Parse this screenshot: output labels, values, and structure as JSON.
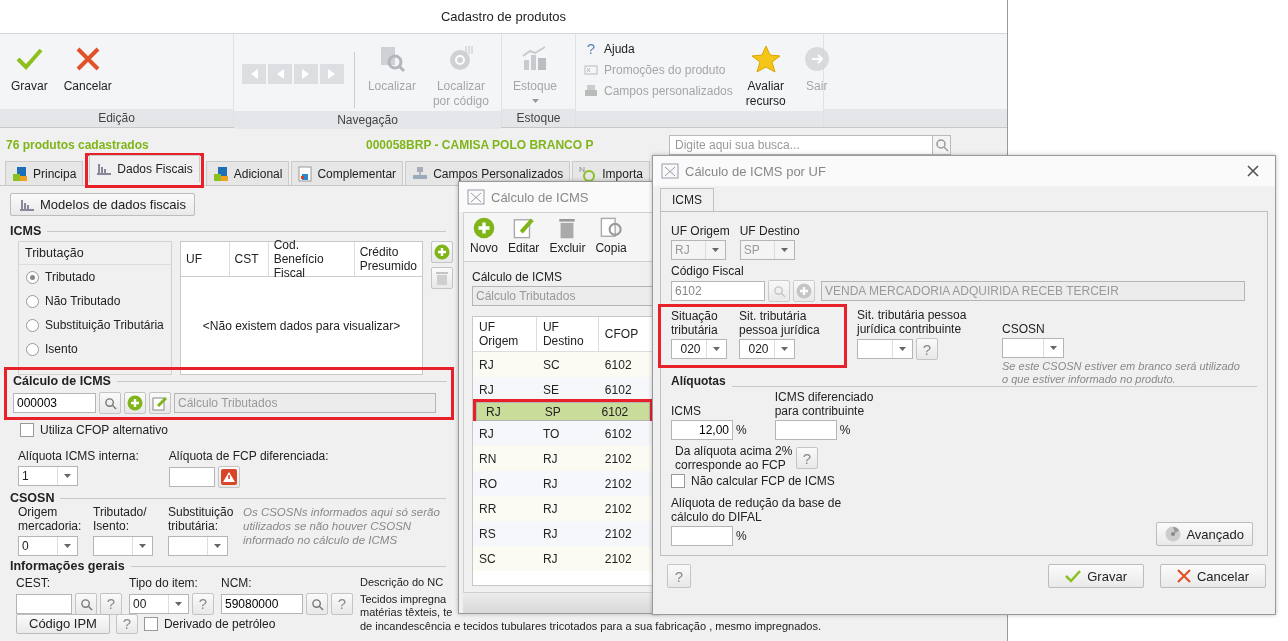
{
  "main_window": {
    "title": "Cadastro de produtos"
  },
  "ribbon": {
    "edit_group": {
      "label": "Edição",
      "save_button": {
        "text": "Gravar",
        "disabled": false
      },
      "cancel_button": {
        "text": "Cancelar",
        "disabled": false
      }
    },
    "navigation_group": {
      "label": "Navegação",
      "pager": {
        "disabled": true
      },
      "find_button": {
        "text": "Localizar",
        "disabled": true
      },
      "find_by_code_button": {
        "text": "Localizar por código",
        "disabled": true
      }
    },
    "stock_group": {
      "label": "Estoque",
      "stock_button": {
        "text": "Estoque",
        "disabled": true
      }
    },
    "misc_group": {
      "help_link": {
        "mark": "?",
        "text": "Ajuda",
        "disabled": false
      },
      "promotions_link": {
        "text": "Promoções do produto",
        "disabled": true
      },
      "custom_fields_link": {
        "text": "Campos personalizados",
        "disabled": true
      },
      "rate_button": {
        "text": "Avaliar recurso",
        "disabled": false
      },
      "exit_button": {
        "text": "Sair",
        "disabled": true
      }
    }
  },
  "record_bar": {
    "count": "76 produtos cadastrados",
    "product": "000058BRP - CAMISA POLO BRANCO P",
    "search": {
      "placeholder": "Digite aqui sua busca..."
    }
  },
  "tabs": [
    {
      "label": "Principa",
      "selected": false
    },
    {
      "label": "Dados Fiscais",
      "selected": true
    },
    {
      "label": "Adicional",
      "selected": false
    },
    {
      "label": "Complementar",
      "selected": false
    },
    {
      "label": "Campos Personalizados",
      "selected": false
    },
    {
      "label": "Importa",
      "selected": false
    }
  ],
  "fiscal": {
    "models_button": "Modelos de dados fiscais",
    "icms": {
      "title": "ICMS",
      "taxation": {
        "title": "Tributação",
        "options": [
          {
            "label": "Tributado",
            "selected": true
          },
          {
            "label": "Não Tributado",
            "selected": false
          },
          {
            "label": "Substituição Tributária",
            "selected": false
          },
          {
            "label": "Isento",
            "selected": false
          }
        ]
      },
      "table": {
        "columns": [
          "UF",
          "CST",
          "Cod. Benefício Fiscal",
          "Crédito Presumido"
        ],
        "empty_message": "<Não existem dados para visualizar>"
      }
    },
    "icms_calc": {
      "title": "Cálculo de ICMS",
      "code": "000003",
      "name": "Cálculo Tributados"
    },
    "alt_cfop": {
      "label": "Utiliza CFOP alternativo",
      "checked": false
    },
    "internal_rate": {
      "label": "Alíquota ICMS interna:",
      "value": "1"
    },
    "fcp_rate": {
      "label": "Alíquota de FCP diferenciada:"
    },
    "csosn": {
      "title": "CSOSN",
      "fields": [
        {
          "label": "Origem mercadoria:",
          "value": "0"
        },
        {
          "label": "Tributado/ Isento:"
        },
        {
          "label": "Substituição tributária:"
        }
      ],
      "note": "Os CSOSNs informados aqui só serão utilizados se não houver CSOSN informado no cálculo de ICMS"
    },
    "general": {
      "title": "Informações gerais",
      "cest": {
        "label": "CEST:",
        "help": "?"
      },
      "item_type": {
        "label": "Tipo do item:",
        "value": "00",
        "help": "?"
      },
      "ncm": {
        "label": "NCM:",
        "value": "59080000",
        "help": "?"
      },
      "ncm_description": {
        "label": "Descrição do NC",
        "lines": [
          "Tecidos impregna",
          "matérias têxteis, te",
          "de incandescência e tecidos tubulares tricotados para a sua fabricação , mesmo impregnados."
        ]
      },
      "ipm_button": "Código IPM",
      "ipm_help": "?",
      "petroleum": {
        "label": "Derivado de petróleo",
        "checked": false
      }
    }
  },
  "icms_list_dialog": {
    "title": "Cálculo de ICMS",
    "toolbar": [
      "Novo",
      "Editar",
      "Excluir",
      "Copia"
    ],
    "calc_label": "Cálculo de ICMS",
    "calc_value": "Cálculo Tributados",
    "columns": [
      "UF Origem",
      "UF Destino",
      "CFOP"
    ],
    "rows": [
      {
        "cells": [
          "RJ",
          "SC",
          "6102"
        ],
        "selected": false
      },
      {
        "cells": [
          "RJ",
          "SE",
          "6102"
        ],
        "selected": false
      },
      {
        "cells": [
          "RJ",
          "SP",
          "6102"
        ],
        "selected": true
      },
      {
        "cells": [
          "RJ",
          "TO",
          "6102"
        ],
        "selected": false
      },
      {
        "cells": [
          "RN",
          "RJ",
          "2102"
        ],
        "selected": false
      },
      {
        "cells": [
          "RO",
          "RJ",
          "2102"
        ],
        "selected": false
      },
      {
        "cells": [
          "RR",
          "RJ",
          "2102"
        ],
        "selected": false
      },
      {
        "cells": [
          "RS",
          "RJ",
          "2102"
        ],
        "selected": false
      },
      {
        "cells": [
          "SC",
          "RJ",
          "2102"
        ],
        "selected": false
      }
    ]
  },
  "uf_dialog": {
    "title": "Cálculo de ICMS por UF",
    "tab": "ICMS",
    "origin": {
      "label": "UF Origem",
      "value": "RJ",
      "disabled": true
    },
    "destination": {
      "label": "UF Destino",
      "value": "SP",
      "disabled": true
    },
    "fiscal_code": {
      "label": "Código Fiscal",
      "value": "6102",
      "disabled": true,
      "description": "VENDA MERCADORIA ADQUIRIDA RECEB TERCEIR"
    },
    "tax_situation": {
      "label": "Situação tributária",
      "value": "020"
    },
    "legal_entity_situation": {
      "label": "Sit. tributária pessoa jurídica",
      "value": "020"
    },
    "contributor_situation": {
      "label": "Sit. tributária pessoa jurídica contribuinte",
      "help": "?"
    },
    "csosn": {
      "label": "CSOSN",
      "note": "Se este CSOSN estiver em branco será utilizado o que estiver informado no produto."
    },
    "rates_title": "Alíquotas",
    "icms": {
      "label": "ICMS",
      "value": "12,00",
      "unit": "%"
    },
    "differentiated": {
      "label": "ICMS diferenciado para contribuinte",
      "unit": "%"
    },
    "fcp_note": "Da alíquota acima 2% corresponde ao FCP",
    "fcp_help": "?",
    "no_fcp": {
      "label": "Não calcular FCP de ICMS",
      "checked": false
    },
    "difal": {
      "label": "Alíquota de redução da base de cálculo do DIFAL",
      "unit": "%"
    },
    "advanced_button": "Avançado",
    "footer_help": "?",
    "save_button": "Gravar",
    "cancel_button": "Cancelar"
  }
}
